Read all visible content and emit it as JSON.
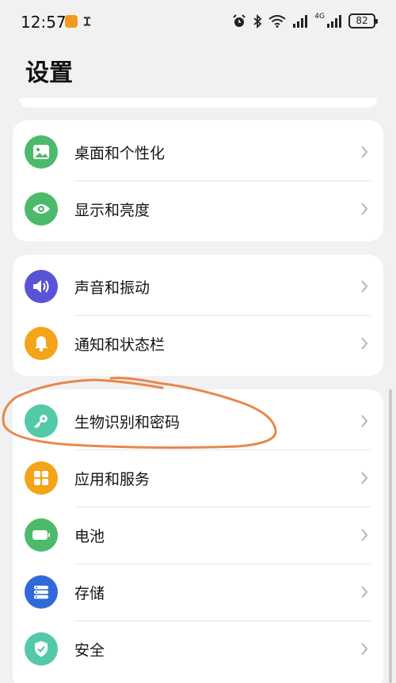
{
  "status_bar": {
    "time": "12:57",
    "battery": "82",
    "network": "4G"
  },
  "header": {
    "title": "设置"
  },
  "groups": [
    {
      "items": [
        {
          "label": "桌面和个性化",
          "icon": "wallpaper-icon",
          "color": "#4cba6a"
        },
        {
          "label": "显示和亮度",
          "icon": "eye-icon",
          "color": "#4cba6a"
        }
      ]
    },
    {
      "items": [
        {
          "label": "声音和振动",
          "icon": "speaker-icon",
          "color": "#5b53d6"
        },
        {
          "label": "通知和状态栏",
          "icon": "bell-icon",
          "color": "#f4a419"
        }
      ]
    },
    {
      "items": [
        {
          "label": "生物识别和密码",
          "icon": "key-icon",
          "color": "#53c9a7"
        },
        {
          "label": "应用和服务",
          "icon": "apps-grid-icon",
          "color": "#f4a419"
        },
        {
          "label": "电池",
          "icon": "battery-icon",
          "color": "#4cba6a"
        },
        {
          "label": "存储",
          "icon": "storage-icon",
          "color": "#2f6ad8"
        },
        {
          "label": "安全",
          "icon": "shield-icon",
          "color": "#53c9a7"
        }
      ]
    }
  ],
  "colors": {
    "annotation": "#e8874a",
    "background": "#f1f1f3"
  }
}
